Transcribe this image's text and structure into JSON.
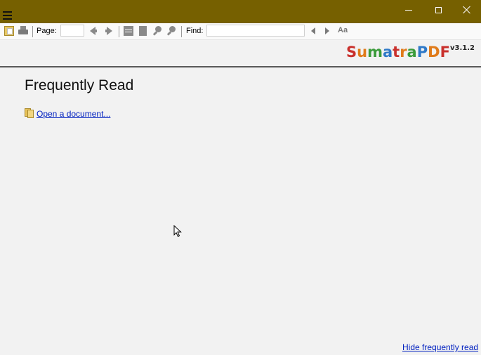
{
  "window": {
    "titlebar_color": "#766000",
    "menu_icon": "hamburger-icon",
    "controls": {
      "minimize_icon": "minimize-icon",
      "maximize_icon": "maximize-icon",
      "close_icon": "close-icon"
    }
  },
  "toolbar": {
    "open_icon": "open-folder-icon",
    "print_icon": "print-icon",
    "page_label": "Page:",
    "page_value": "",
    "prev_icon": "arrow-left-icon",
    "next_icon": "arrow-right-icon",
    "fit_page_icon": "fit-page-icon",
    "fit_width_icon": "fit-width-icon",
    "zoom_out_icon": "zoom-out-icon",
    "zoom_in_icon": "zoom-in-icon",
    "find_label": "Find:",
    "find_value": "",
    "find_prev_icon": "triangle-left-icon",
    "find_next_icon": "triangle-right-icon",
    "match_case_icon": "match-case-icon"
  },
  "logo": {
    "letters": [
      {
        "ch": "S",
        "color": "#c9302c"
      },
      {
        "ch": "u",
        "color": "#e07b1a"
      },
      {
        "ch": "m",
        "color": "#3a9b3a"
      },
      {
        "ch": "a",
        "color": "#2f79c8"
      },
      {
        "ch": "t",
        "color": "#c9302c"
      },
      {
        "ch": "r",
        "color": "#e07b1a"
      },
      {
        "ch": "a",
        "color": "#3a9b3a"
      },
      {
        "ch": "P",
        "color": "#2f79c8"
      },
      {
        "ch": "D",
        "color": "#e07b1a"
      },
      {
        "ch": "F",
        "color": "#c9302c"
      }
    ],
    "version": "v3.1.2"
  },
  "main": {
    "heading": "Frequently Read",
    "open_document": "Open a document...",
    "hide_frequently_read": "Hide frequently read"
  }
}
